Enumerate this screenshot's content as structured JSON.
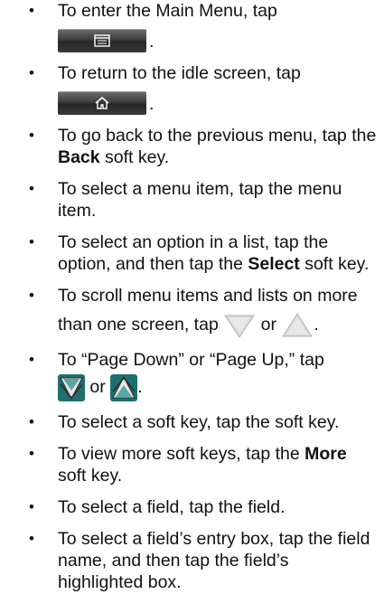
{
  "bullets": [
    {
      "pre": "To enter the Main Menu, tap",
      "post": ".",
      "button_icon": "menu-icon"
    },
    {
      "pre": "To return to the idle screen, tap",
      "post": ".",
      "button_icon": "home-icon"
    },
    {
      "pre": "To go back to the previous menu, tap the ",
      "bold": "Back",
      "post": " soft key."
    },
    {
      "text": "To select a menu item, tap the menu item."
    },
    {
      "pre": "To select an option in a list, tap the option, and then tap the ",
      "bold": "Select",
      "post": " soft key."
    },
    {
      "line1": "To scroll menu items and lists on more",
      "line2_pre": "than one screen, tap",
      "or": "or",
      "post": ".",
      "icons": [
        "scroll-down-icon",
        "scroll-up-icon"
      ]
    },
    {
      "line1": "To “Page Down” or “Page Up,” tap",
      "or": "or",
      "post": ".",
      "icons": [
        "page-down-icon",
        "page-up-icon"
      ]
    },
    {
      "text": "To select a soft key, tap the soft key."
    },
    {
      "pre": "To view more soft keys, tap the ",
      "bold": "More",
      "post": " soft key."
    },
    {
      "text": "To select a field, tap the field."
    },
    {
      "text": "To select a field’s entry box, tap the field name, and then tap the field’s highlighted box."
    }
  ],
  "colors": {
    "button_dark": "#3a3a3a",
    "arrow_light": "#cfcfcf",
    "page_arrow_teal": "#2e8f8f"
  }
}
